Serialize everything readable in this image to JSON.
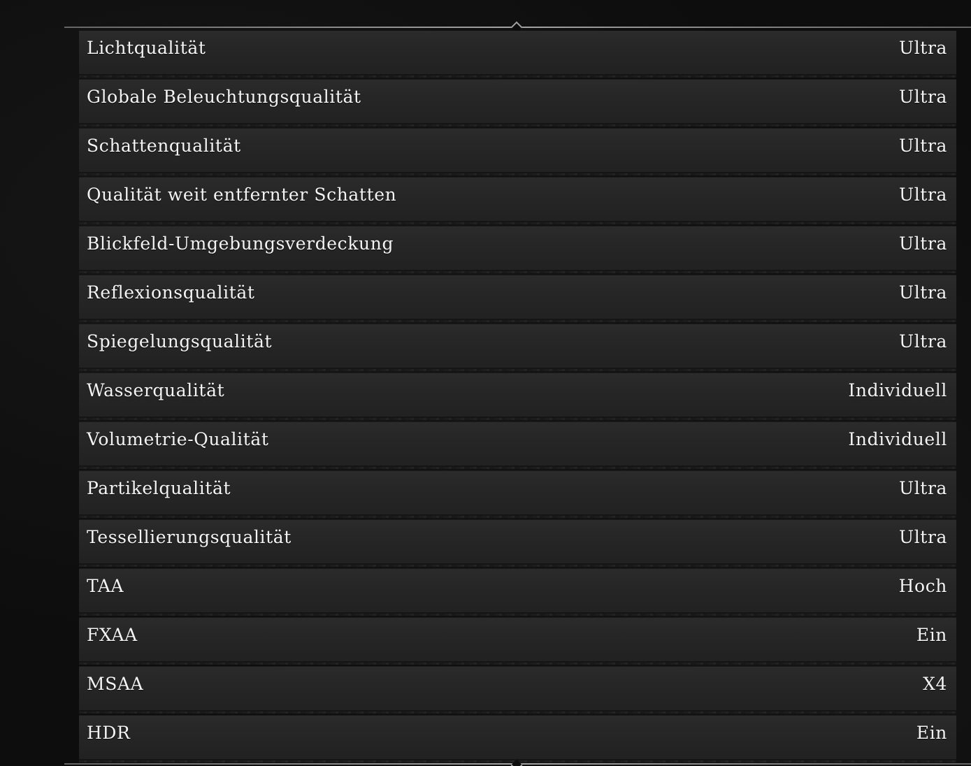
{
  "settings": [
    {
      "label": "Lichtqualität",
      "value": "Ultra"
    },
    {
      "label": "Globale Beleuchtungsqualität",
      "value": "Ultra"
    },
    {
      "label": "Schattenqualität",
      "value": "Ultra"
    },
    {
      "label": "Qualität weit entfernter Schatten",
      "value": "Ultra"
    },
    {
      "label": "Blickfeld-Umgebungsverdeckung",
      "value": "Ultra"
    },
    {
      "label": "Reflexionsqualität",
      "value": "Ultra"
    },
    {
      "label": "Spiegelungsqualität",
      "value": "Ultra"
    },
    {
      "label": "Wasserqualität",
      "value": "Individuell"
    },
    {
      "label": "Volumetrie-Qualität",
      "value": "Individuell"
    },
    {
      "label": "Partikelqualität",
      "value": "Ultra"
    },
    {
      "label": "Tessellierungsqualität",
      "value": "Ultra"
    },
    {
      "label": "TAA",
      "value": "Hoch"
    },
    {
      "label": "FXAA",
      "value": "Ein"
    },
    {
      "label": "MSAA",
      "value": "X4"
    },
    {
      "label": "HDR",
      "value": "Ein"
    }
  ]
}
